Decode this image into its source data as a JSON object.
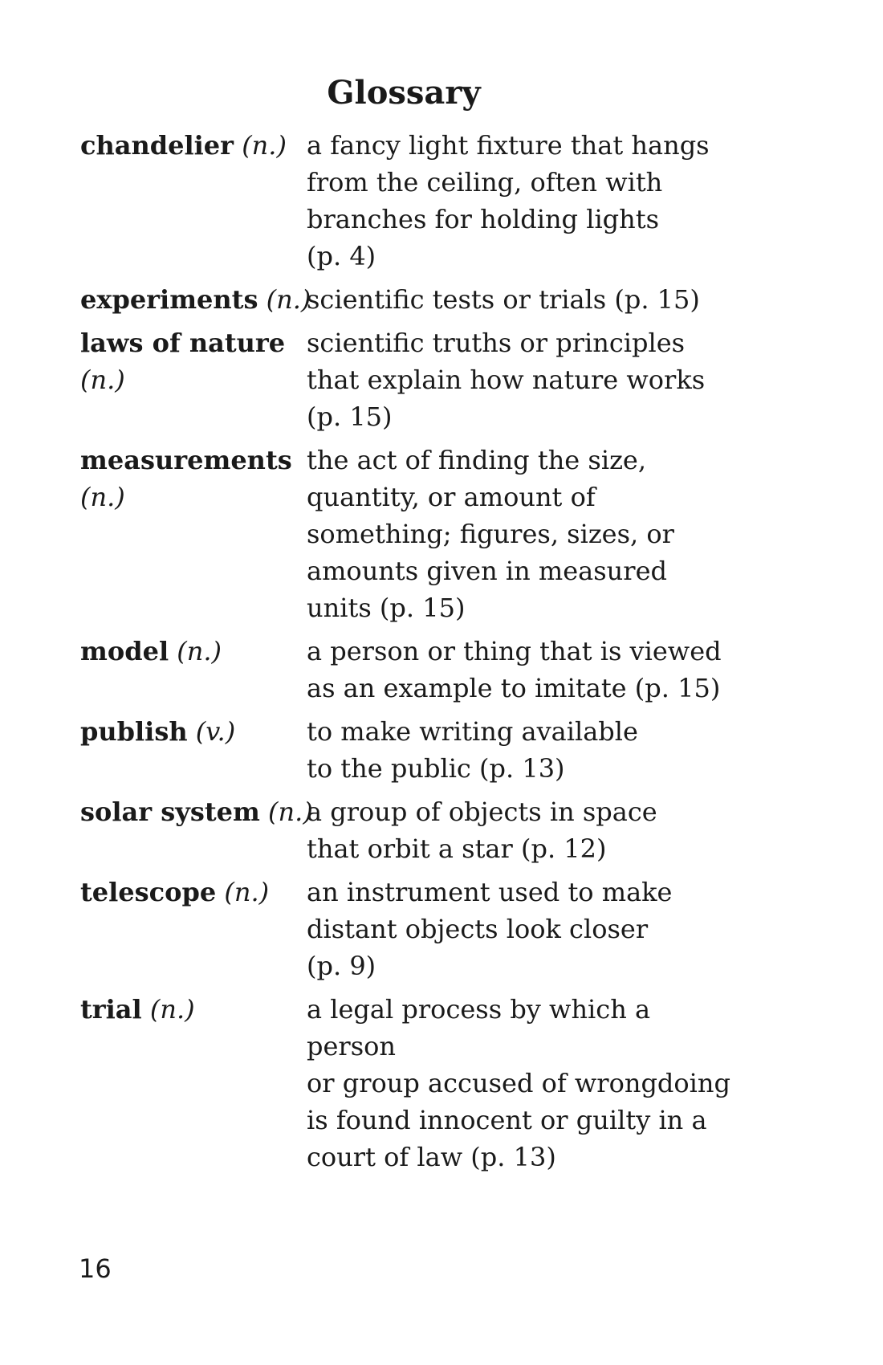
{
  "title": "Glossary",
  "entries": [
    {
      "term": "chandelier",
      "pos": "(n.)",
      "definition": "a fancy light fixture that hangs\nfrom the ceiling, often with\nbranches for holding lights\n(p. 4)"
    },
    {
      "term": "experiments",
      "pos": "(n.)",
      "definition": "scientific tests or trials (p. 15)"
    },
    {
      "term": "laws of nature",
      "pos": "(n.)",
      "definition": "scientific truths or principles\nthat explain how nature works\n(p. 15)"
    },
    {
      "term": "measurements",
      "pos": "(n.)",
      "definition": "the act of finding the size,\nquantity, or amount of\nsomething; figures, sizes, or\namounts given in measured\nunits (p. 15)"
    },
    {
      "term": "model",
      "pos": "(n.)",
      "definition": "a person or thing that is viewed\nas an example to imitate (p. 15)"
    },
    {
      "term": "publish",
      "pos": "(v.)",
      "definition": "to make writing available\nto the public (p. 13)"
    },
    {
      "term": "solar system",
      "pos": "(n.)",
      "definition": "a group of objects in space\nthat orbit a star (p. 12)"
    },
    {
      "term": "telescope",
      "pos": "(n.)",
      "definition": "an instrument used to make\ndistant objects look closer\n(p. 9)"
    },
    {
      "term": "trial",
      "pos": "(n.)",
      "definition": "a legal process by which a person\nor group accused of wrongdoing\nis found innocent or guilty in a\ncourt of law (p. 13)"
    }
  ],
  "page_number": "16"
}
